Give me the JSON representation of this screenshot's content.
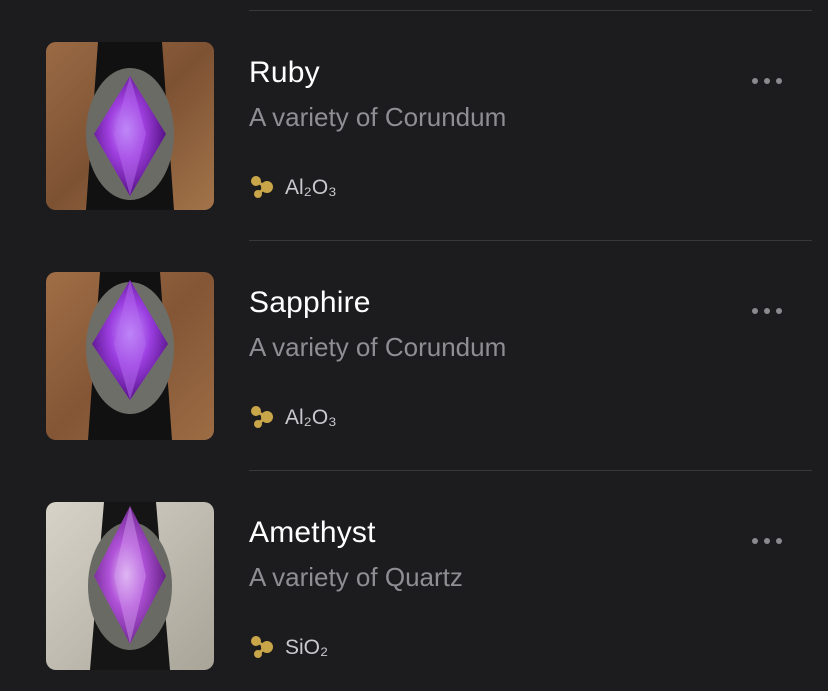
{
  "colors": {
    "background": "#1c1c1e",
    "title": "#ffffff",
    "subtitle": "#8e8e93",
    "formula_icon": "#c9a54a",
    "divider": "#38383b"
  },
  "gems": [
    {
      "name": "Ruby",
      "variety": "A variety of Corundum",
      "formula": "Al₂O₃",
      "thumbnail": "purple-marquise-ring-photo",
      "formula_icon": "molecule-icon",
      "more_icon": "ellipsis-icon"
    },
    {
      "name": "Sapphire",
      "variety": "A variety of Corundum",
      "formula": "Al₂O₃",
      "thumbnail": "purple-marquise-ring-photo",
      "formula_icon": "molecule-icon",
      "more_icon": "ellipsis-icon"
    },
    {
      "name": "Amethyst",
      "variety": "A variety of Quartz",
      "formula": "SiO₂",
      "thumbnail": "purple-marquise-ring-photo",
      "formula_icon": "molecule-icon",
      "more_icon": "ellipsis-icon"
    }
  ]
}
